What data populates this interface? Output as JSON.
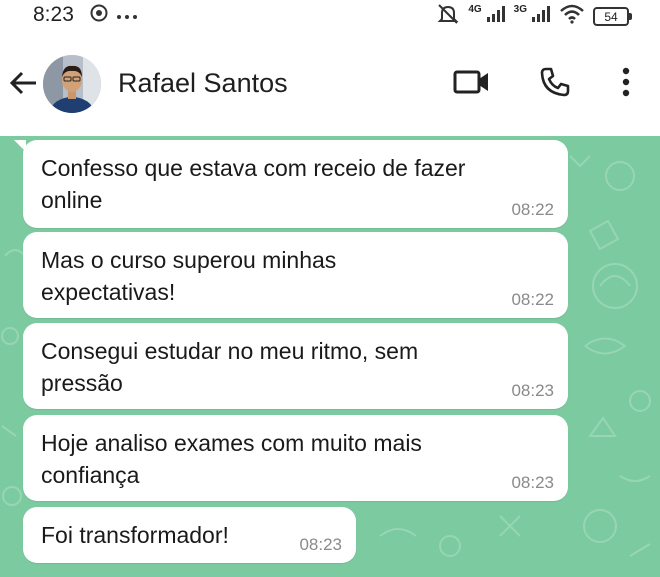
{
  "status_bar": {
    "time": "8:23",
    "net_4g": "4G",
    "net_3g": "3G",
    "battery": "54"
  },
  "header": {
    "contact_name": "Rafael Santos"
  },
  "messages": [
    {
      "lines": [
        "Confesso que estava com receio de fazer",
        "online"
      ],
      "time": "08:22"
    },
    {
      "lines": [
        "Mas o curso superou minhas",
        "expectativas!"
      ],
      "time": "08:22"
    },
    {
      "lines": [
        "Consegui estudar no meu ritmo, sem",
        "pressão"
      ],
      "time": "08:23"
    },
    {
      "lines": [
        "Hoje analiso exames com muito mais",
        "confiança"
      ],
      "time": "08:23"
    },
    {
      "lines": [
        "Foi transformador!"
      ],
      "time": "08:23"
    }
  ],
  "colors": {
    "chat_background": "#7ccaa0",
    "bubble": "#ffffff",
    "timestamp": "#8a8a8a"
  }
}
